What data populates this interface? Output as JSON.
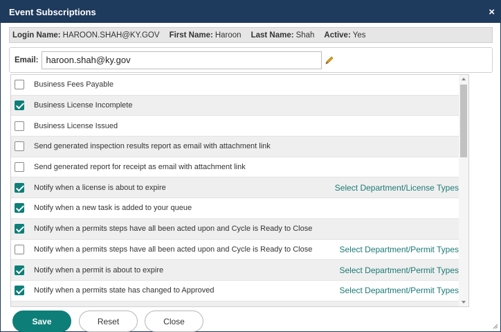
{
  "dialog": {
    "title": "Event Subscriptions",
    "close_glyph": "×"
  },
  "user": {
    "login_label": "Login Name:",
    "login_value": "HAROON.SHAH@KY.GOV",
    "first_label": "First Name:",
    "first_value": "Haroon",
    "last_label": "Last Name:",
    "last_value": "Shah",
    "active_label": "Active:",
    "active_value": "Yes"
  },
  "email": {
    "label": "Email:",
    "value": "haroon.shah@ky.gov",
    "edit_icon": "pencil-icon"
  },
  "subscriptions": [
    {
      "label": "Business Fees Payable",
      "checked": false,
      "link": ""
    },
    {
      "label": "Business License Incomplete",
      "checked": true,
      "link": ""
    },
    {
      "label": "Business License Issued",
      "checked": false,
      "link": ""
    },
    {
      "label": "Send generated inspection results report as email with attachment link",
      "checked": false,
      "link": ""
    },
    {
      "label": "Send generated report for receipt as email with attachment link",
      "checked": false,
      "link": ""
    },
    {
      "label": "Notify when a license is about to expire",
      "checked": true,
      "link": "Select Department/License Types"
    },
    {
      "label": "Notify when a new task is added to your queue",
      "checked": true,
      "link": ""
    },
    {
      "label": "Notify when a permits steps have all been acted upon and Cycle is Ready to Close",
      "checked": true,
      "link": ""
    },
    {
      "label": "Notify when a permits steps have all been acted upon and Cycle is Ready to Close",
      "checked": false,
      "link": "Select Department/Permit Types"
    },
    {
      "label": "Notify when a permit is about to expire",
      "checked": true,
      "link": "Select Department/Permit Types"
    },
    {
      "label": "Notify when a permits state has changed to Approved",
      "checked": true,
      "link": "Select Department/Permit Types"
    },
    {
      "label": "",
      "checked": true,
      "link": ""
    }
  ],
  "buttons": {
    "save": "Save",
    "reset": "Reset",
    "close": "Close"
  },
  "colors": {
    "titlebar": "#1e3a5c",
    "accent": "#0d7f78",
    "link": "#1a7a74",
    "pencil": "#e0a020"
  }
}
